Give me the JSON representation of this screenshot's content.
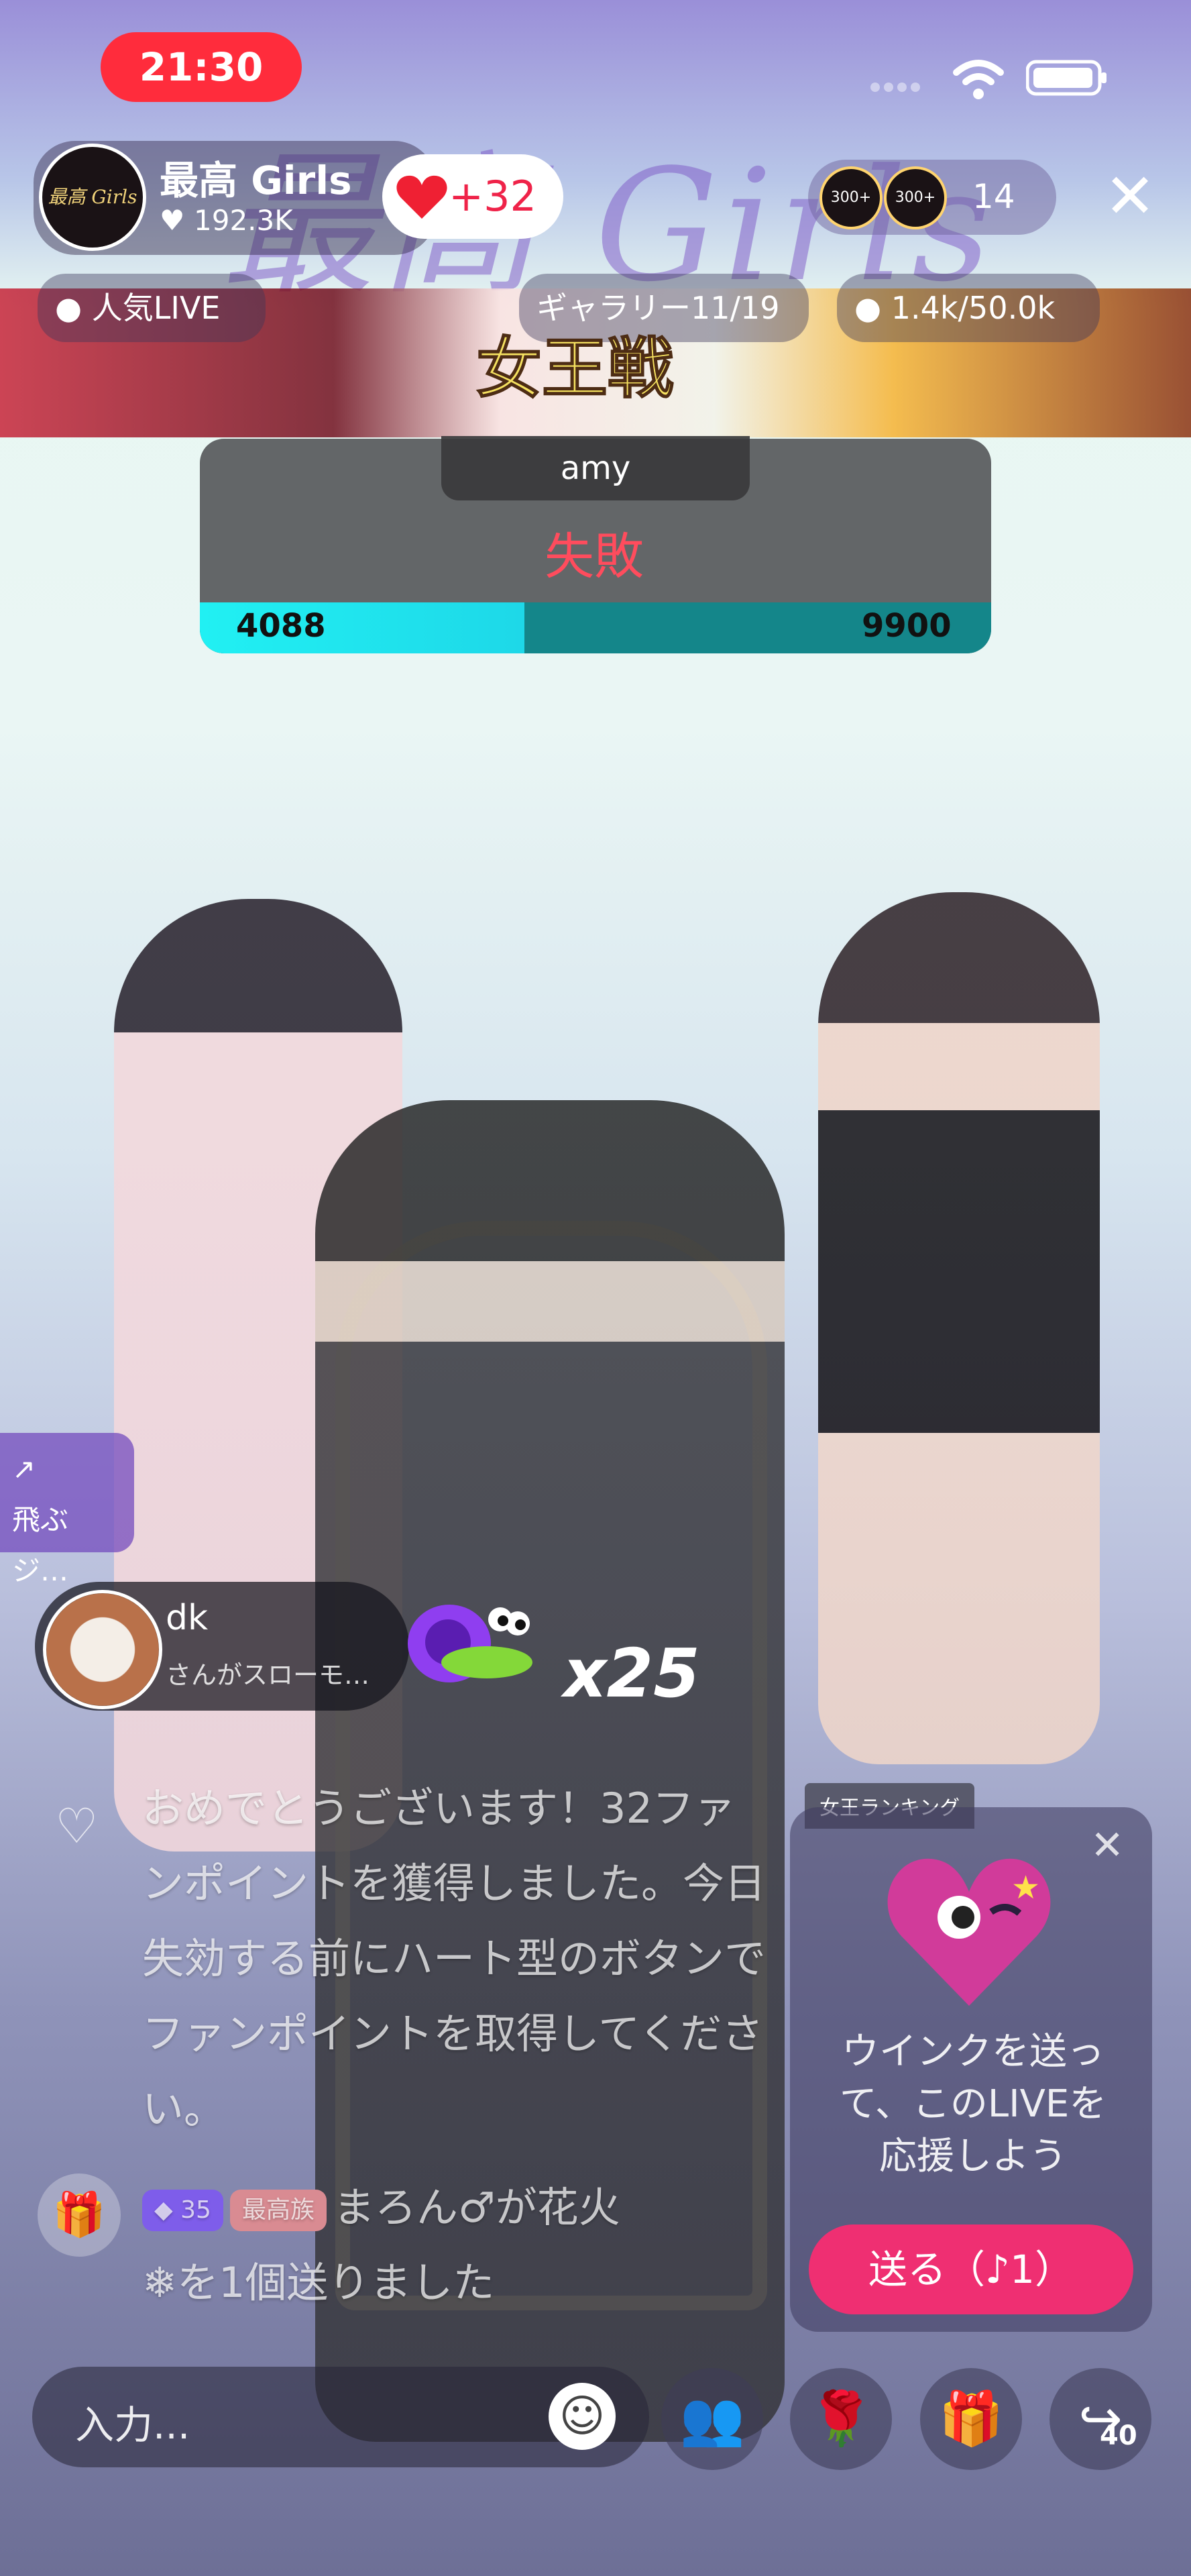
{
  "status": {
    "time": "21:30"
  },
  "background_title": "最高 Girls",
  "host": {
    "avatar_text": "最高 Girls",
    "name": "最高 Girls",
    "likes": "192.3K",
    "heart_delta": "+32"
  },
  "viewers": {
    "badges": [
      "300+",
      "300+"
    ],
    "count": "14"
  },
  "tabs": {
    "popular_live": "人気LIVE",
    "gallery": "ギャラリー11/19",
    "counter": "1.4k/50.0k"
  },
  "battle": {
    "title": "女王戦",
    "amy": "amy",
    "result": "失敗",
    "score_left": "4088",
    "score_right": "9900",
    "progress_percent": 41
  },
  "side_card": {
    "line1": "飛ぶジ…"
  },
  "gift": {
    "user": "dk",
    "message": "さんがスローモ…",
    "count": "x25"
  },
  "chat": {
    "message": "おめでとうございます！32ファンポイントを獲得しました。今日失効する前にハート型のボタンでファンポイントを取得してください。",
    "diamond": "35",
    "fan_badge": "最高族",
    "username": "まろん♂",
    "gift_text": "が花火",
    "sent_text": "を1個送りました"
  },
  "promo": {
    "title": "女王ランキング",
    "text": "ウインクを送って、このLIVEを応援しよう",
    "button": "送る（♪1）"
  },
  "input": {
    "placeholder": "入力..."
  },
  "share": {
    "count": "40"
  },
  "colors": {
    "accent": "#ef2f72",
    "live_red": "#ff2c3c",
    "progress": "#21f0f3",
    "fail": "#ff4c5d"
  }
}
